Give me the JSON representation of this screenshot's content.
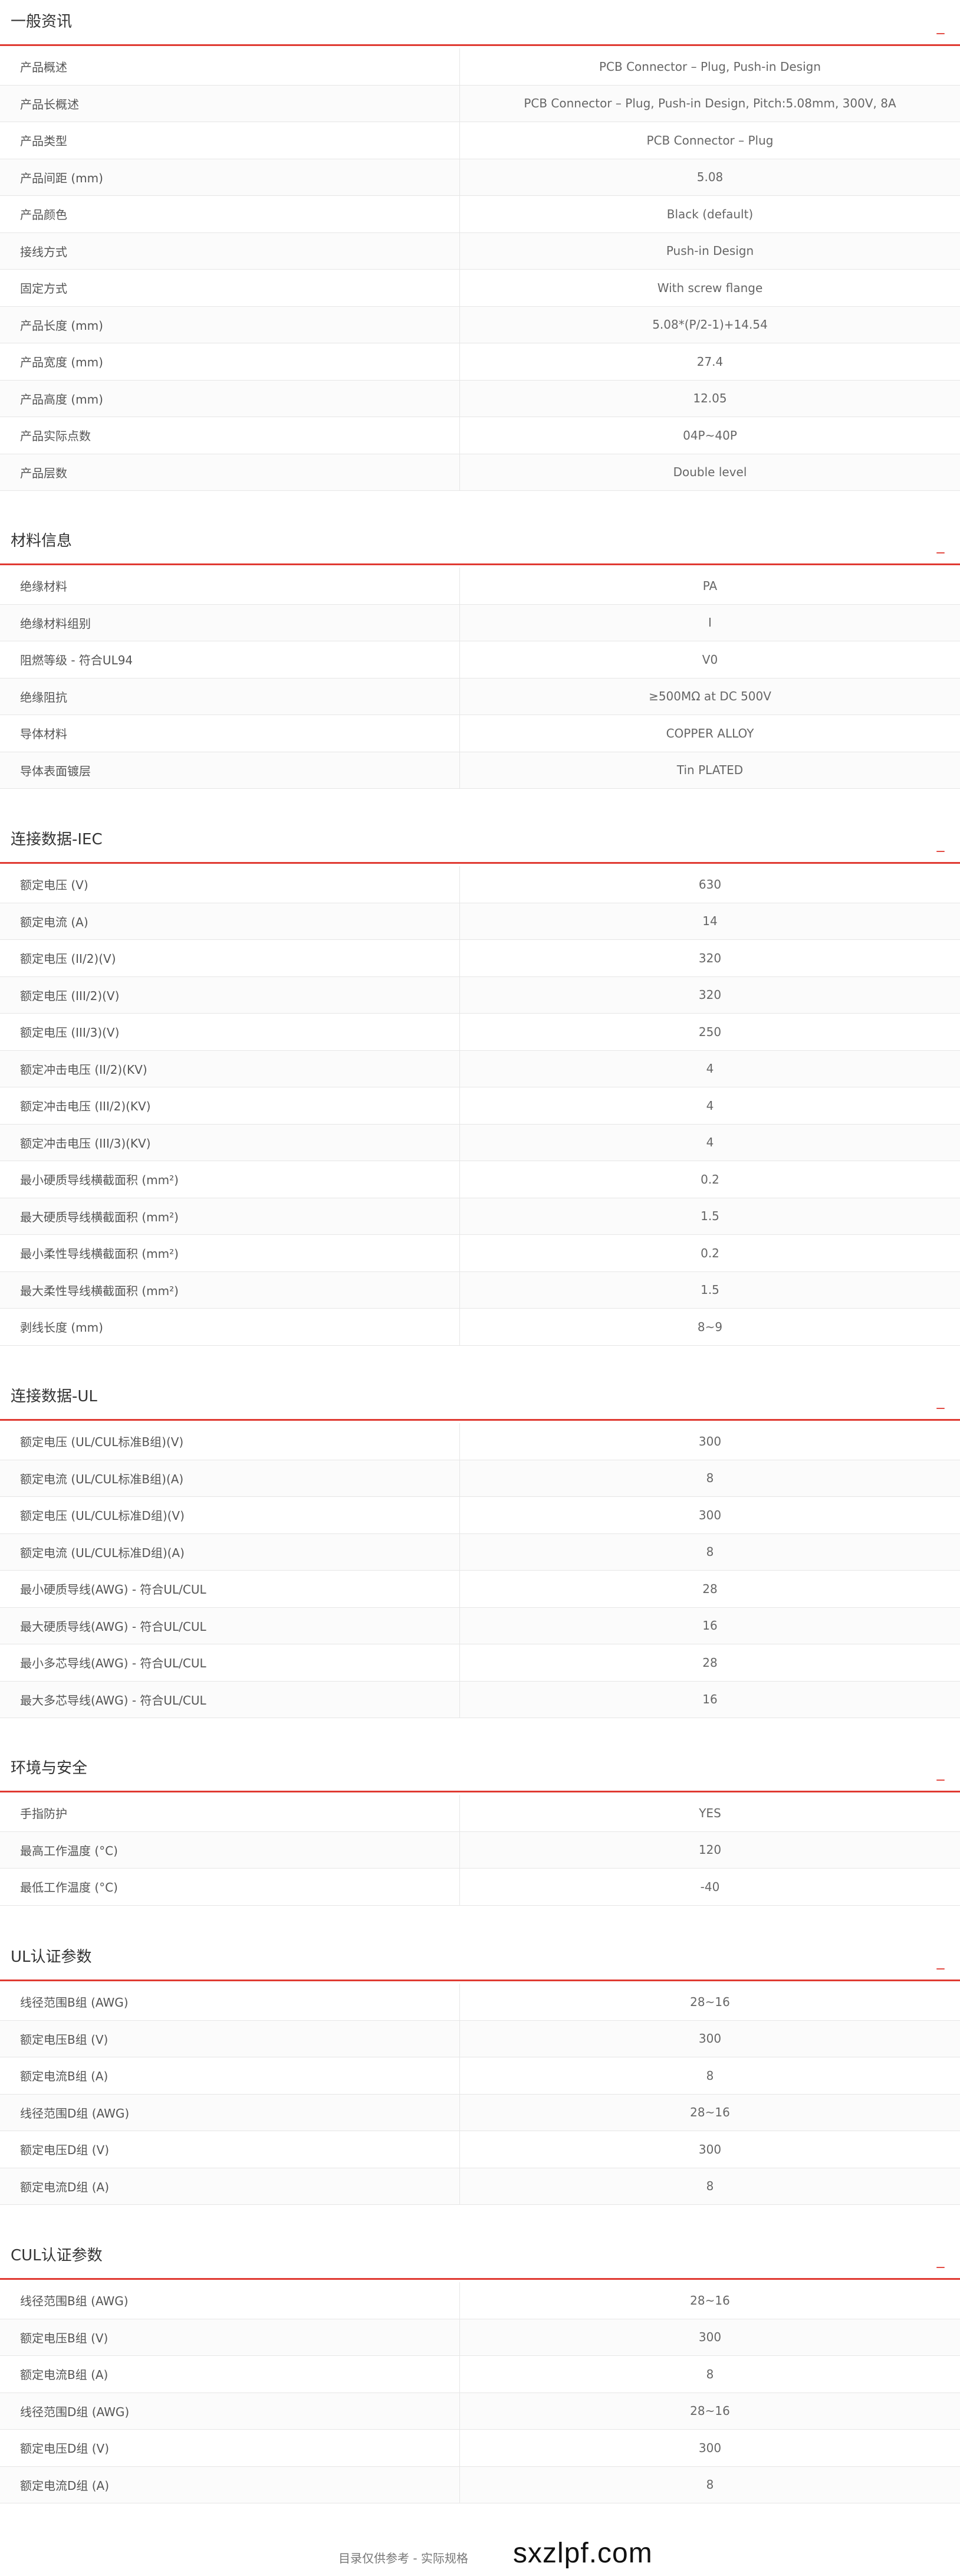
{
  "sections": [
    {
      "id": "general",
      "title": "一般资讯",
      "toggle": "_",
      "rows": [
        [
          "产品概述",
          "PCB Connector – Plug, Push-in Design"
        ],
        [
          "产品长概述",
          "PCB Connector – Plug, Push-in Design, Pitch:5.08mm, 300V, 8A"
        ],
        [
          "产品类型",
          "PCB Connector – Plug"
        ],
        [
          "产品间距 (mm)",
          "5.08"
        ],
        [
          "产品颜色",
          "Black (default)"
        ],
        [
          "接线方式",
          "Push-in Design"
        ],
        [
          "固定方式",
          "With screw flange"
        ],
        [
          "产品长度 (mm)",
          "5.08*(P/2-1)+14.54"
        ],
        [
          "产品宽度 (mm)",
          "27.4"
        ],
        [
          "产品高度 (mm)",
          "12.05"
        ],
        [
          "产品实际点数",
          "04P~40P"
        ],
        [
          "产品层数",
          "Double level"
        ]
      ]
    },
    {
      "id": "material",
      "title": "材料信息",
      "toggle": "_",
      "rows": [
        [
          "绝缘材料",
          "PA"
        ],
        [
          "绝缘材料组别",
          "I"
        ],
        [
          "阻燃等级 - 符合UL94",
          "V0"
        ],
        [
          "绝缘阻抗",
          "≥500MΩ at DC 500V"
        ],
        [
          "导体材料",
          "COPPER ALLOY"
        ],
        [
          "导体表面镀层",
          "Tin PLATED"
        ]
      ]
    },
    {
      "id": "iec",
      "title": "连接数据-IEC",
      "toggle": "_",
      "rows": [
        [
          "额定电压 (V)",
          "630"
        ],
        [
          "额定电流 (A)",
          "14"
        ],
        [
          "额定电压 (II/2)(V)",
          "320"
        ],
        [
          "额定电压 (III/2)(V)",
          "320"
        ],
        [
          "额定电压 (III/3)(V)",
          "250"
        ],
        [
          "额定冲击电压 (II/2)(KV)",
          "4"
        ],
        [
          "额定冲击电压 (III/2)(KV)",
          "4"
        ],
        [
          "额定冲击电压 (III/3)(KV)",
          "4"
        ],
        [
          "最小硬质导线横截面积 (mm²)",
          "0.2"
        ],
        [
          "最大硬质导线横截面积 (mm²)",
          "1.5"
        ],
        [
          "最小柔性导线横截面积 (mm²)",
          "0.2"
        ],
        [
          "最大柔性导线横截面积 (mm²)",
          "1.5"
        ],
        [
          "剥线长度 (mm)",
          "8~9"
        ]
      ]
    },
    {
      "id": "ul-conn",
      "title": "连接数据-UL",
      "toggle": "_",
      "rows": [
        [
          "额定电压 (UL/CUL标准B组)(V)",
          "300"
        ],
        [
          "额定电流 (UL/CUL标准B组)(A)",
          "8"
        ],
        [
          "额定电压 (UL/CUL标准D组)(V)",
          "300"
        ],
        [
          "额定电流 (UL/CUL标准D组)(A)",
          "8"
        ],
        [
          "最小硬质导线(AWG) - 符合UL/CUL",
          "28"
        ],
        [
          "最大硬质导线(AWG) - 符合UL/CUL",
          "16"
        ],
        [
          "最小多芯导线(AWG) - 符合UL/CUL",
          "28"
        ],
        [
          "最大多芯导线(AWG) - 符合UL/CUL",
          "16"
        ]
      ]
    },
    {
      "id": "env",
      "title": "环境与安全",
      "toggle": "_",
      "rows": [
        [
          "手指防护",
          "YES"
        ],
        [
          "最高工作温度 (°C)",
          "120"
        ],
        [
          "最低工作温度 (°C)",
          "-40"
        ]
      ]
    },
    {
      "id": "ul-cert",
      "title": "UL认证参数",
      "toggle": "_",
      "rows": [
        [
          "线径范围B组 (AWG)",
          "28~16"
        ],
        [
          "额定电压B组 (V)",
          "300"
        ],
        [
          "额定电流B组 (A)",
          "8"
        ],
        [
          "线径范围D组 (AWG)",
          "28~16"
        ],
        [
          "额定电压D组 (V)",
          "300"
        ],
        [
          "额定电流D组 (A)",
          "8"
        ]
      ]
    },
    {
      "id": "cul-cert",
      "title": "CUL认证参数",
      "toggle": "_",
      "rows": [
        [
          "线径范围B组 (AWG)",
          "28~16"
        ],
        [
          "额定电压B组 (V)",
          "300"
        ],
        [
          "额定电流B组 (A)",
          "8"
        ],
        [
          "线径范围D组 (AWG)",
          "28~16"
        ],
        [
          "额定电压D组 (V)",
          "300"
        ],
        [
          "额定电流D组 (A)",
          "8"
        ]
      ]
    }
  ],
  "footer": {
    "note": "目录仅供参考 - 实际规格",
    "watermark": "sxzlpf.com"
  },
  "colors": {
    "accent": "#e03a32",
    "border": "#e6e6e6",
    "text": "#555555"
  }
}
